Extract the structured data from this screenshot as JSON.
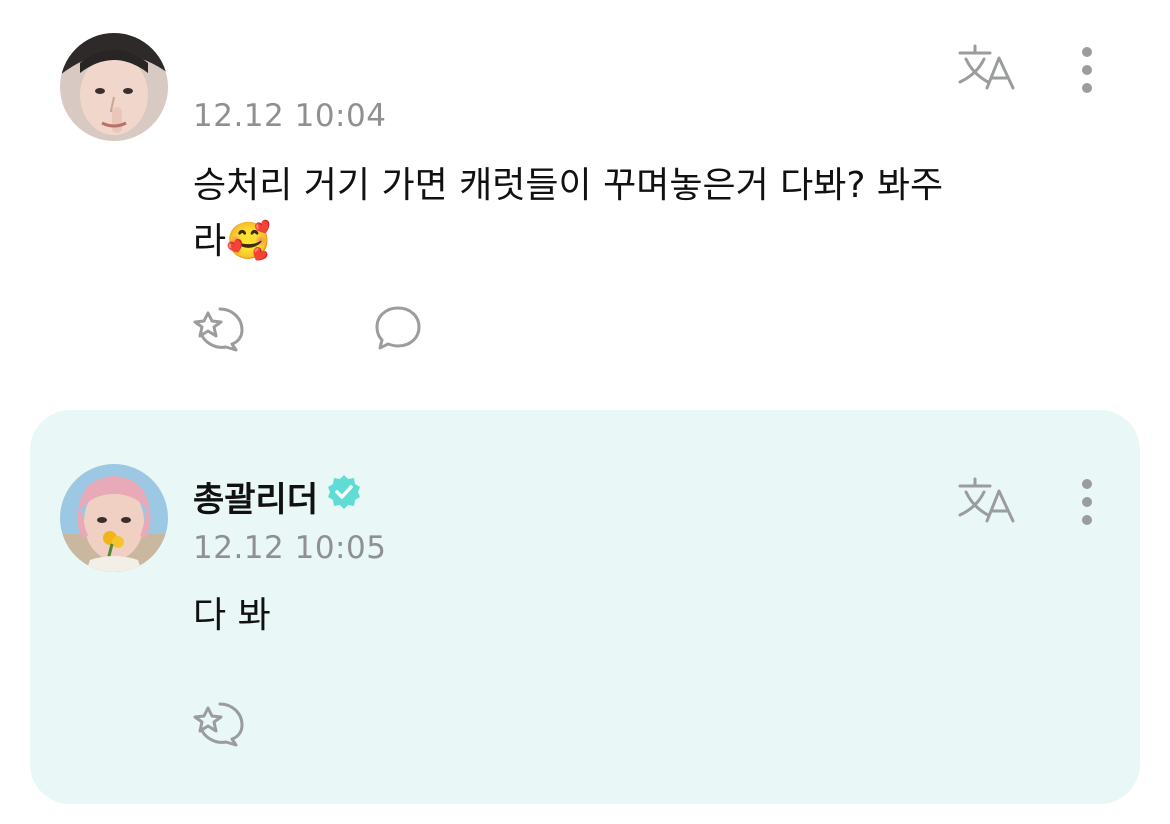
{
  "comment": {
    "timestamp": "12.12 10:04",
    "text_line1": "승처리 거기 가면 캐럿들이 꾸며놓은거 다봐? 봐주",
    "text_line2": "라🥰",
    "icons": {
      "translate": "translate-icon",
      "more": "more-vertical-icon",
      "like": "sticker-like-icon",
      "reply": "speech-bubble-icon"
    }
  },
  "reply": {
    "author": "총괄리더",
    "verified": "verified-badge-icon",
    "timestamp": "12.12 10:05",
    "text": "다 봐",
    "icons": {
      "translate": "translate-icon",
      "more": "more-vertical-icon",
      "like": "sticker-like-icon"
    }
  },
  "colors": {
    "reply_background": "#e9f8f6",
    "verified_badge": "#5fdcd4",
    "icon_gray": "#9a9c9e",
    "timestamp_gray": "#8e9092"
  }
}
